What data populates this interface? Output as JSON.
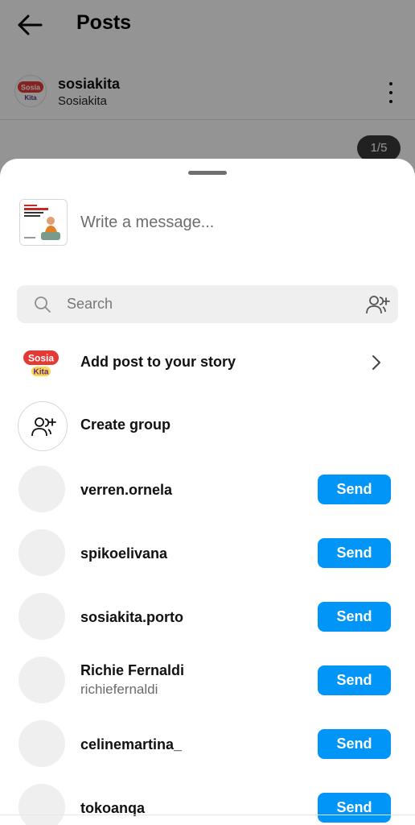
{
  "header": {
    "title": "Posts"
  },
  "post": {
    "username": "sosiakita",
    "full_name": "Sosiakita",
    "counter": "1/5",
    "avatar_text_top": "Sosia",
    "avatar_text_bottom": "Kita"
  },
  "share_sheet": {
    "message_placeholder": "Write a message...",
    "search_placeholder": "Search",
    "add_to_story_label": "Add post to your story",
    "create_group_label": "Create group",
    "send_label": "Send",
    "story_logo_top": "Sosia",
    "story_logo_bottom": "Kita"
  },
  "contacts": [
    {
      "username": "verren.ornela",
      "subtitle": ""
    },
    {
      "username": "spikoelivana",
      "subtitle": ""
    },
    {
      "username": "sosiakita.porto",
      "subtitle": ""
    },
    {
      "username": "Richie Fernaldi",
      "subtitle": "richiefernaldi"
    },
    {
      "username": "celinemartina_",
      "subtitle": ""
    },
    {
      "username": "tokoanqa",
      "subtitle": ""
    }
  ],
  "colors": {
    "send_button": "#0095f6",
    "overlay": "rgba(0,0,0,0.42)",
    "brand_red": "#e53935",
    "brand_purple": "#5a2a82"
  },
  "icons": {
    "back": "arrow-left-icon",
    "more": "vertical-ellipsis-icon",
    "search": "magnifier-icon",
    "add_people": "add-people-icon",
    "chevron": "chevron-right-icon",
    "group": "group-icon"
  }
}
